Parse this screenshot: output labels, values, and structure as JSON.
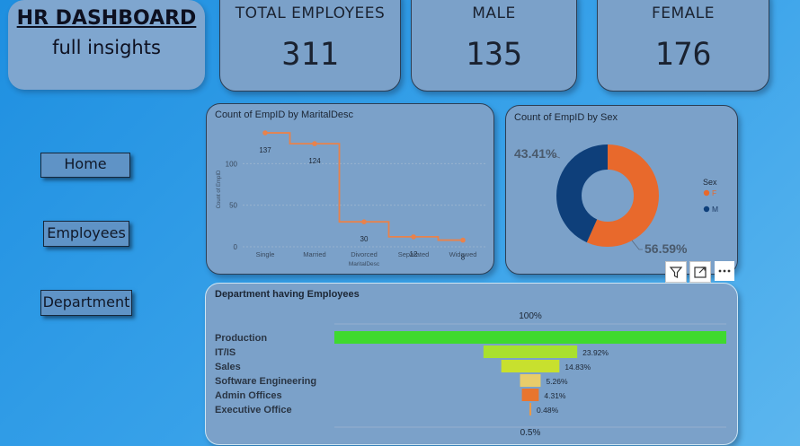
{
  "header": {
    "title": "HR DASHBOARD",
    "subtitle": "full insights"
  },
  "kpis": [
    {
      "label": "TOTAL EMPLOYEES",
      "value": "311"
    },
    {
      "label": "MALE",
      "value": "135"
    },
    {
      "label": "FEMALE",
      "value": "176"
    }
  ],
  "nav": {
    "home": "Home",
    "employees": "Employees",
    "department": "Department"
  },
  "visual_toolbar": {
    "icons": [
      "filter-icon",
      "focus-mode-icon",
      "more-options-icon"
    ]
  },
  "chart_data": [
    {
      "type": "line",
      "title": "Count of EmpID by MaritalDesc",
      "xlabel": "MaritalDesc",
      "ylabel": "Count of EmpID",
      "categories": [
        "Single",
        "Married",
        "Divorced",
        "Separated",
        "Widowed"
      ],
      "values": [
        137,
        124,
        30,
        12,
        8
      ],
      "data_labels": [
        "137",
        "124",
        "30",
        "12",
        "8"
      ],
      "yticks": [
        "0",
        "50",
        "100"
      ],
      "ylim": [
        0,
        150
      ],
      "color": "#e8824c",
      "step": true,
      "grid": true
    },
    {
      "type": "pie",
      "donut": true,
      "title": "Count of EmpID by Sex",
      "legend_title": "Sex",
      "legend_position": "right",
      "slices": [
        {
          "label": "F",
          "value": 56.59,
          "display": "56.59%",
          "color": "#e8692c"
        },
        {
          "label": "M",
          "value": 43.41,
          "display": "43.41%",
          "color": "#0e3f7a"
        }
      ]
    },
    {
      "type": "bar",
      "subtype": "funnel",
      "title": "Department having Employees",
      "top_label": "100%",
      "bottom_label": "0.5%",
      "categories": [
        "Production",
        "IT/IS",
        "Sales",
        "Software Engineering",
        "Admin Offices",
        "Executive Office"
      ],
      "values": [
        100,
        23.92,
        14.83,
        5.26,
        4.31,
        0.48
      ],
      "value_labels": [
        "",
        "23.92%",
        "14.83%",
        "5.26%",
        "4.31%",
        "0.48%"
      ],
      "colors": [
        "#3fd92e",
        "#a9e02e",
        "#c8e02e",
        "#e8cc6a",
        "#e8752e",
        "#e89a4a"
      ]
    }
  ]
}
